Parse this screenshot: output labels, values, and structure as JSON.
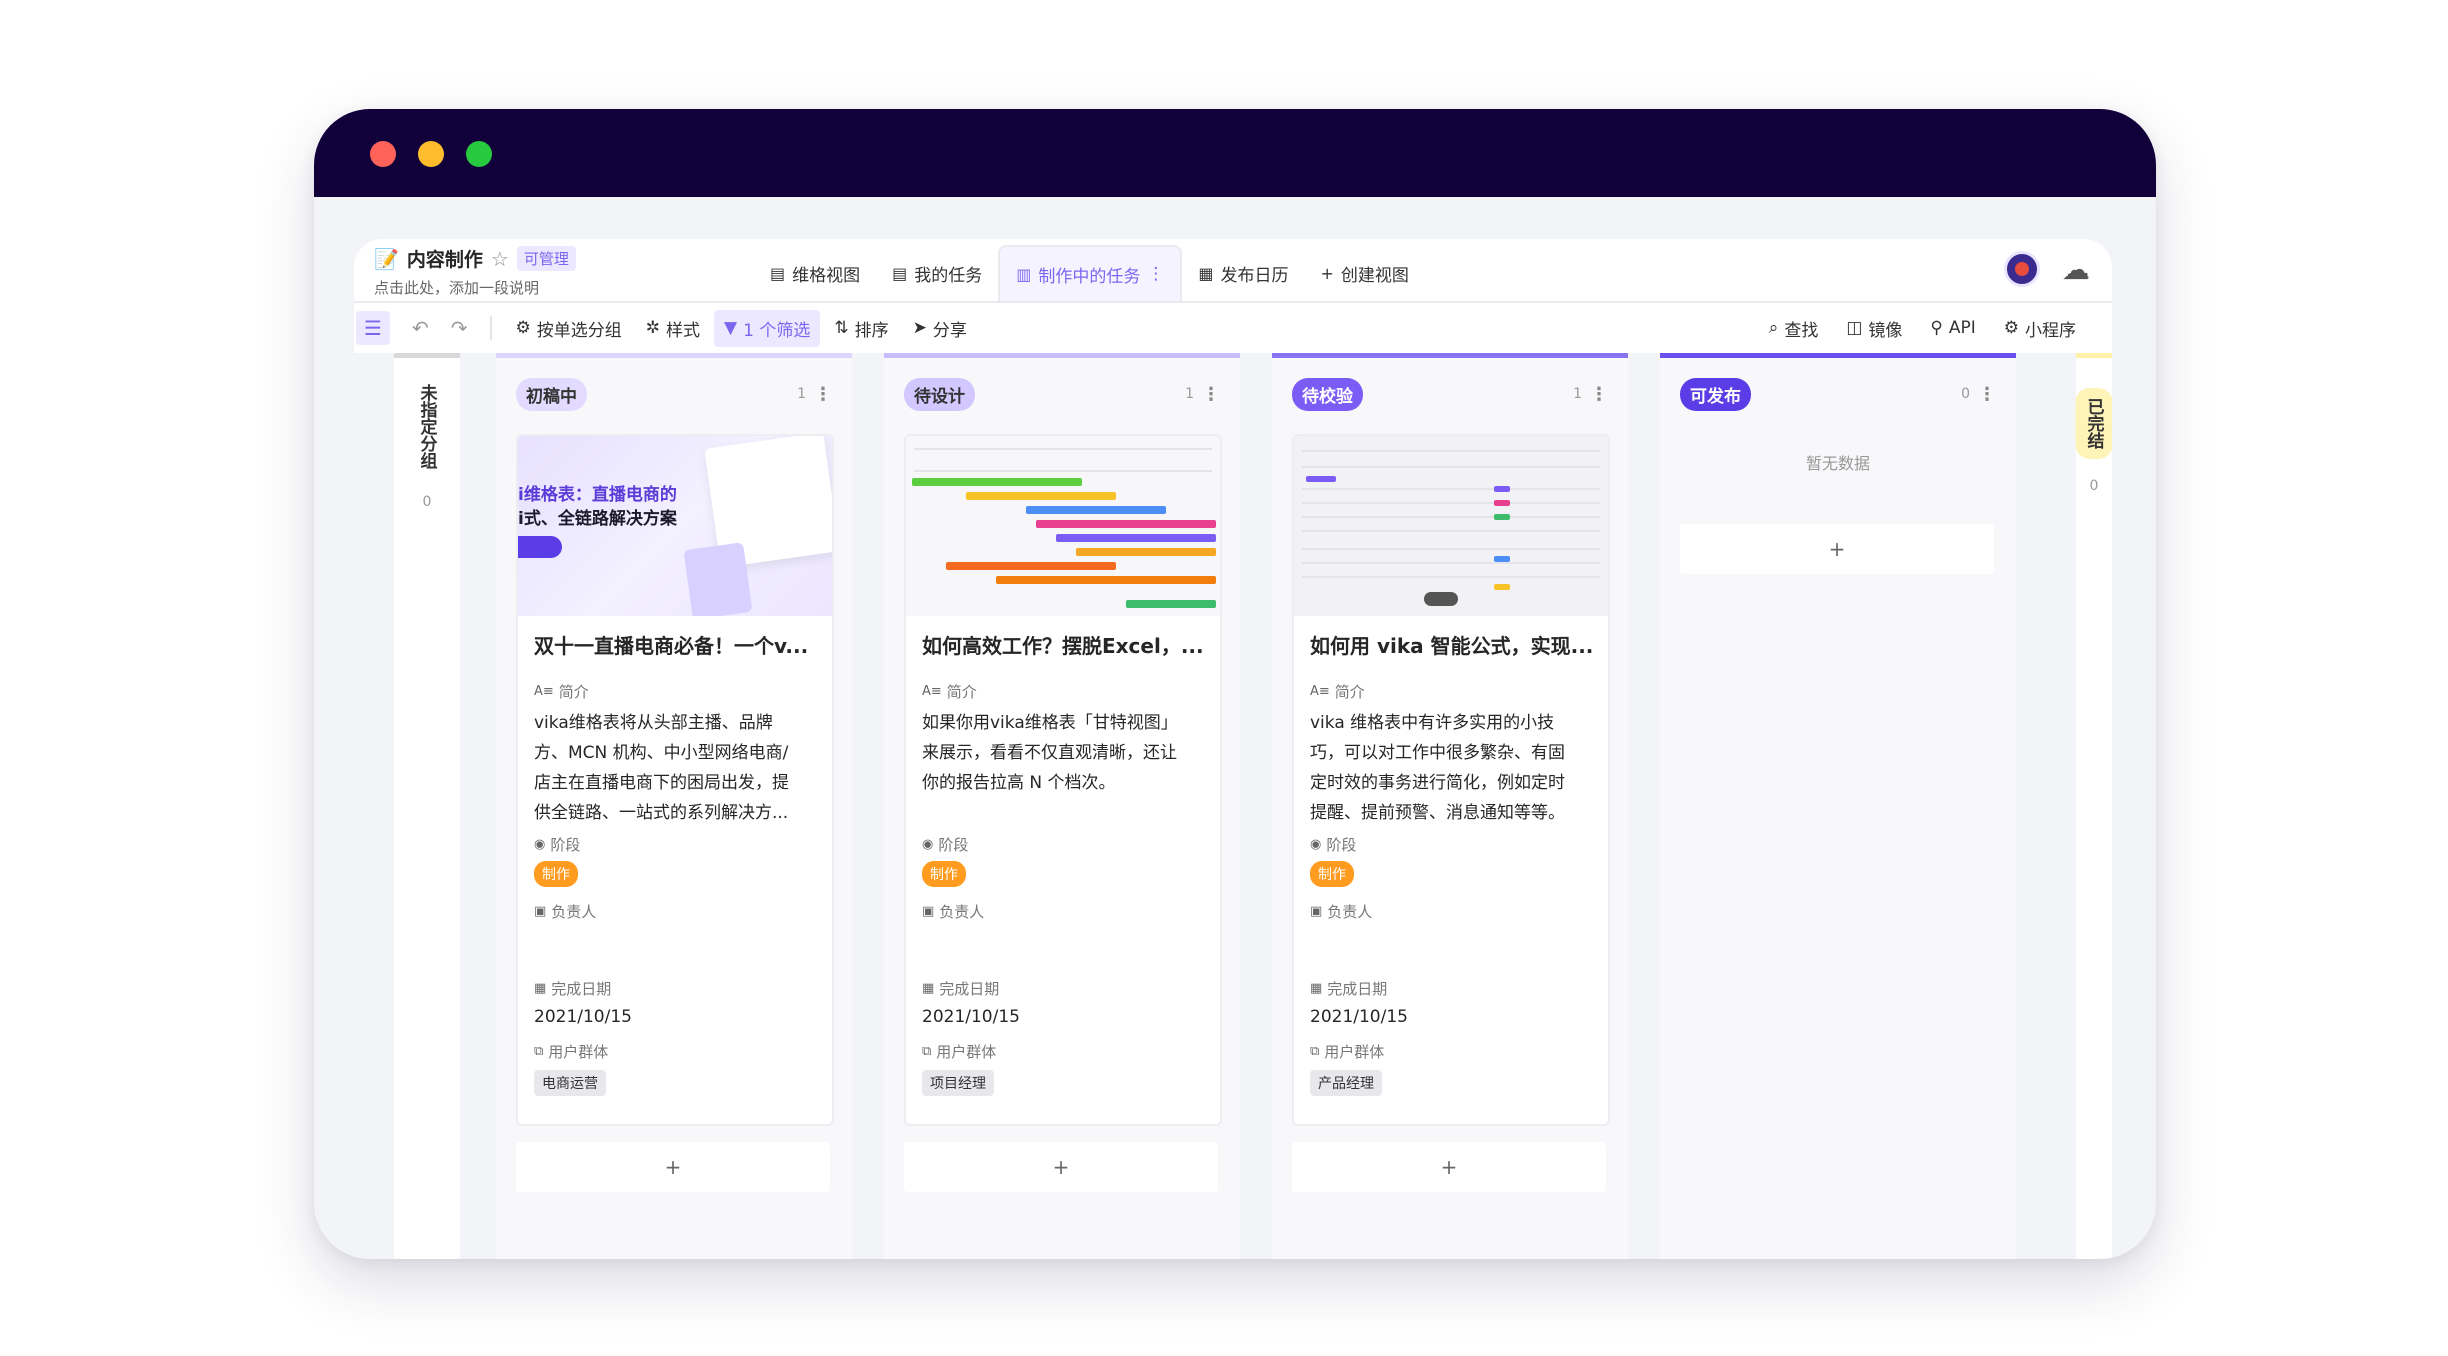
{
  "app": {
    "title": "内容制作",
    "permission": "可管理",
    "description": "点击此处，添加一段说明"
  },
  "tabs": [
    {
      "label": "维格视图",
      "icon": "grid-icon"
    },
    {
      "label": "我的任务",
      "icon": "grid-icon"
    },
    {
      "label": "制作中的任务",
      "icon": "kanban-icon",
      "active": true
    },
    {
      "label": "发布日历",
      "icon": "calendar-icon"
    },
    {
      "label": "创建视图",
      "icon": "plus-icon"
    }
  ],
  "toolbar": {
    "group": "按单选分组",
    "style": "样式",
    "filter": "1 个筛选",
    "sort": "排序",
    "share": "分享",
    "find": "查找",
    "mirror": "镜像",
    "api": "API",
    "widget": "小程序"
  },
  "side_groups": {
    "left": {
      "label": "未指定分组",
      "count": "0"
    },
    "right": {
      "label": "已完结",
      "count": "0"
    }
  },
  "columns": [
    {
      "label": "初稿中",
      "count": "1",
      "card": {
        "cover_title_line1": "i维格表：直播电商的",
        "cover_title_line2": "i式、全链路解决方案",
        "title": "双十一直播电商必备！一个v...",
        "intro_label": "简介",
        "intro": [
          "vika维格表将从头部主播、品牌",
          "方、MCN 机构、中小型网络电商/",
          "店主在直播电商下的困局出发，提",
          "供全链路、一站式的系列解决方..."
        ],
        "stage_label": "阶段",
        "stage": "制作",
        "owner_label": "负责人",
        "date_label": "完成日期",
        "date": "2021/10/15",
        "user_label": "用户群体",
        "user": "电商运营"
      }
    },
    {
      "label": "待设计",
      "count": "1",
      "card": {
        "title": "如何高效工作？摆脱Excel，...",
        "intro_label": "简介",
        "intro": [
          "如果你用vika维格表「甘特视图」",
          "来展示，看看不仅直观清晰，还让",
          "你的报告拉高 N 个档次。"
        ],
        "stage_label": "阶段",
        "stage": "制作",
        "owner_label": "负责人",
        "date_label": "完成日期",
        "date": "2021/10/15",
        "user_label": "用户群体",
        "user": "项目经理"
      }
    },
    {
      "label": "待校验",
      "count": "1",
      "card": {
        "title": "如何用 vika 智能公式，实现...",
        "intro_label": "简介",
        "intro": [
          "vika 维格表中有许多实用的小技",
          "巧，可以对工作中很多繁杂、有固",
          "定时效的事务进行简化，例如定时",
          "提醒、提前预警、消息通知等等。"
        ],
        "stage_label": "阶段",
        "stage": "制作",
        "owner_label": "负责人",
        "date_label": "完成日期",
        "date": "2021/10/15",
        "user_label": "用户群体",
        "user": "产品经理"
      }
    },
    {
      "label": "可发布",
      "count": "0",
      "empty": "暂无数据"
    }
  ],
  "add_label": "+"
}
